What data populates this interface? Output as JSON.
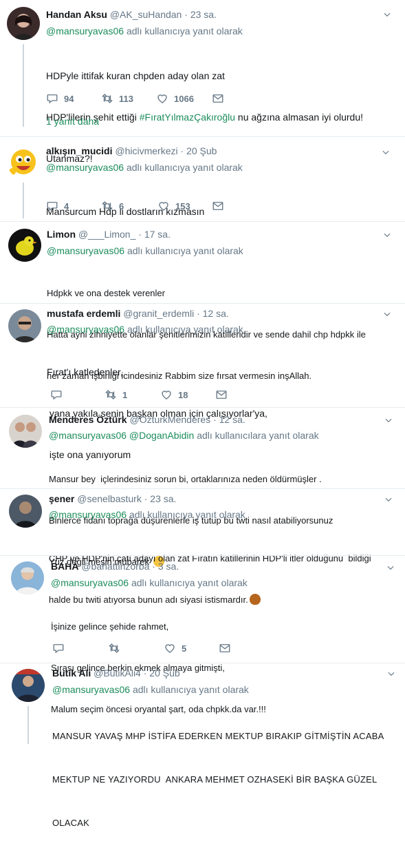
{
  "tweets": [
    {
      "name": "Handan Aksu",
      "handle": "@AK_suHandan",
      "time": "23 sa.",
      "reply_prefix": "",
      "reply_mentions": "@mansuryavas06",
      "reply_suffix": "adlı kullanıcıya yanıt olarak",
      "line1": "HDPyle ittifak kuran chpden aday olan zat",
      "line2_a": "HDP'lilerin şehit ettiği ",
      "line2_tag": "#FıratYılmazÇakıroğlu",
      "line2_b": " nu ağzına almasan iyi olurdu!",
      "line3": "Utanmaz?!",
      "replies": "94",
      "retweets": "113",
      "likes": "1066",
      "more_replies": "1 yanıt daha"
    },
    {
      "name": "alkışın_mucidi",
      "handle": "@hicivmerkezi",
      "time": "20 Şub",
      "reply_mentions": "@mansuryavas06",
      "reply_suffix": "adlı kullanıcıya yanıt olarak",
      "line1": "Mansurcum Hdp li dostların kızmasın",
      "replies": "4",
      "retweets": "6",
      "likes": "153"
    },
    {
      "name": "Limon",
      "handle": "@___Limon_",
      "time": "17 sa.",
      "reply_mentions": "@mansuryavas06",
      "reply_suffix": "adlı kullanıcıya yanıt olarak",
      "line1": "Hdpkk ve ona destek verenler",
      "line2": "Hatta ayni zihniyette olanlar şehitlerimizin katilleridir ve sende dahil chp hdpkk ile",
      "line3": "her zaman işbirliği icindesiniz Rabbim size fırsat vermesin inşAllah."
    },
    {
      "name": "mustafa erdemli",
      "handle": "@granit_erdemli",
      "time": "12 sa.",
      "reply_mentions": "@mansuryavas06",
      "reply_suffix": "adlı kullanıcıya yanıt olarak",
      "line1": "Fırat'ı katledenler,",
      "line2": " yana yakıla senin başkan olman için çalışıyorlar'ya,",
      "line3": " işte ona yanıyorum",
      "replies": "",
      "retweets": "1",
      "likes": "18"
    },
    {
      "name": "Menderes Öztürk",
      "handle": "@OzturkMenderes",
      "time": "12 sa.",
      "reply_mentions": "@mansuryavas06 @DoganAbidin",
      "reply_suffix": "adlı kullanıcılara yanıt olarak",
      "line1": "Mansur bey  içlerindesiniz sorun bi, ortaklarınıza neden öldürmüşler .",
      "line2": "Binlerce fidanı toprağa düşürenlerle iş tutup bu twti nasıl atabiliyorsunuz",
      "line3": "Yüz değil meşin mübarek"
    },
    {
      "name": "şener",
      "handle": "@senelbasturk",
      "time": "23 sa.",
      "reply_mentions": "@mansuryavas06",
      "reply_suffix": "adlı kullanıcıya yanıt olarak",
      "line1": "CHP ve HDP'nin çatı adayı olan zat Fıratın katillerinin HDP'li itler olduğunu  bildiği",
      "line2": "halde bu twiti atıyorsa bunun adı siyasi istismardır."
    },
    {
      "name": "BAHA",
      "handle": "@bahattinzorba",
      "time": "3 sa.",
      "reply_mentions": "@mansuryavas06",
      "reply_suffix": "adlı kullanıcıya yanıt olarak",
      "line1": "İşinize gelince şehide rahmet,",
      "line2": "Sırası gelince berkin ekmek almaya gitmişti,",
      "line3": "Malum seçim öncesi oryantal şart, oda chpkk.da var.!!!",
      "replies": "",
      "retweets": "",
      "likes": "5"
    },
    {
      "name": "Butik Ali",
      "handle": "@ButikAli4",
      "time": "20 Şub",
      "reply_mentions": "@mansuryavas06",
      "reply_suffix": "adlı kullanıcıya yanıt olarak",
      "line1": "MANSUR YAVAŞ MHP İSTİFA EDERKEN MEKTUP BIRAKIP GİTMİŞTİN ACABA",
      "line2": "MEKTUP NE YAZIYORDU  ANKARA MEHMET OZHASEKİ BİR BAŞKA GÜZEL",
      "line3": "OLACAK"
    }
  ],
  "colors": {
    "accent": "#1b8c5b",
    "muted": "#657786",
    "text": "#14171a",
    "border": "#e6ecf0"
  }
}
